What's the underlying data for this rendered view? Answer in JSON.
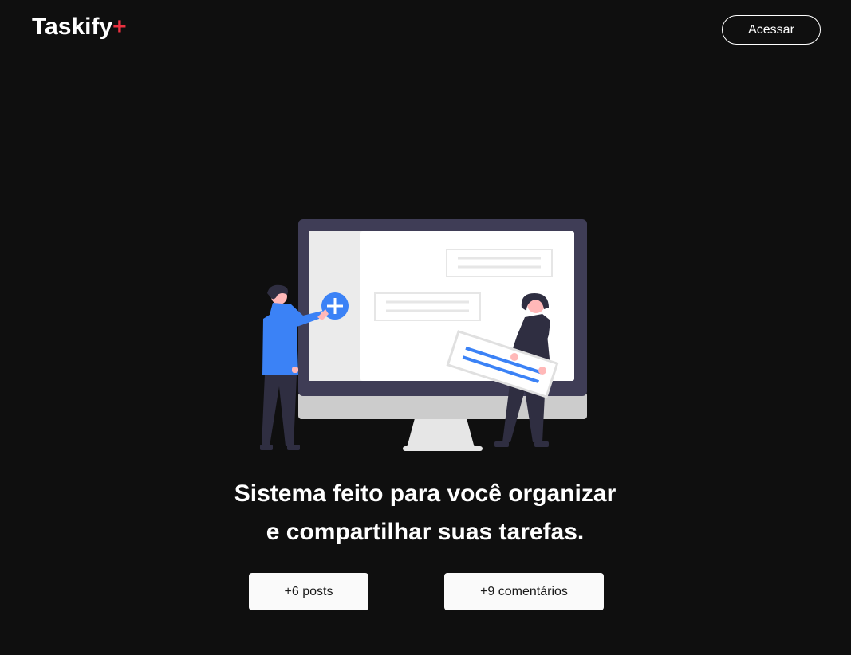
{
  "header": {
    "logo_text": "Taskify",
    "logo_accent": "+",
    "access_button_label": "Acessar"
  },
  "hero": {
    "title_line1": "Sistema feito para você organizar",
    "title_line2": "e compartilhar suas tarefas.",
    "illustration": "person-adding-tasks-to-monitor-illustration"
  },
  "stats": {
    "posts_label": "+6 posts",
    "comments_label": "+9 comentários"
  },
  "colors": {
    "background": "#0f0f0f",
    "accent": "#ea3140",
    "illustration_blue": "#3b82f6",
    "monitor_frame": "#3f3d56",
    "stat_box": "#fafafa"
  }
}
